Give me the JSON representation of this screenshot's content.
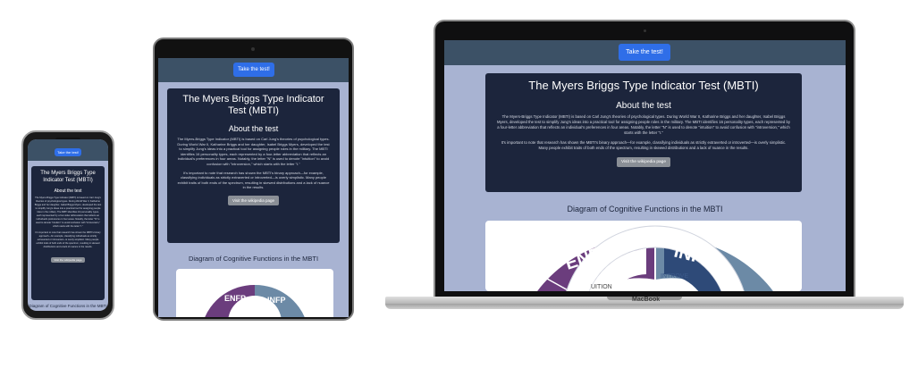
{
  "site": {
    "nav_button": "Take the test!",
    "title": "The Myers Briggs Type Indicator Test (MBTI)",
    "about_heading": "About the test",
    "about_p1": "The Myers-Briggs Type Indicator (MBTI) is based on Carl Jung's theories of psychological types. During World War II, Katharine Briggs and her daughter, Isabel Briggs Myers, developed the test to simplify Jung's ideas into a practical tool for assigning people roles in the military. The MBTI identifies 16 personality types, each represented by a four-letter abbreviation that reflects an individual's preferences in four areas. Notably, the letter \"N\" is used to denote \"intuition\" to avoid confusion with \"introversion,\" which starts with the letter \"I.\"",
    "about_p2": "It's important to note that research has shown the MBTI's binary approach—for example, classifying individuals as strictly extraverted or introverted—is overly simplistic. Many people exhibit traits of both ends of the spectrum, resulting in skewed distributions and a lack of nuance in the results.",
    "wiki_button": "Visit the wikipedia page",
    "diagram_title": "Diagram of Cognitive Functions in the MBTI",
    "segments": {
      "enfp": "ENFP",
      "infp": "INFP",
      "introversion": "INTROVE",
      "extraversion": "UITION"
    }
  },
  "devices": {
    "laptop_brand": "MacBook"
  },
  "colors": {
    "page_bg": "#a8b3d2",
    "navbar": "#3c5166",
    "card": "#1c253c",
    "primary": "#2f6ee8",
    "secondary": "#8a8f96",
    "enfp": "#6b3d7d",
    "infp": "#6c8aa6"
  }
}
